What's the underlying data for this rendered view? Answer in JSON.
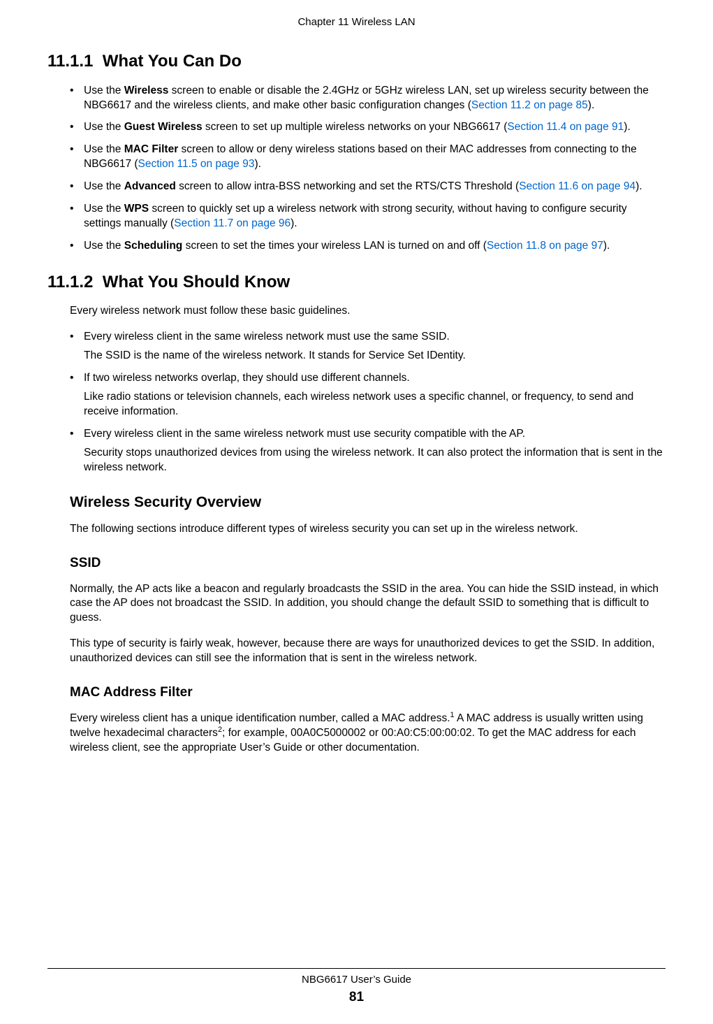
{
  "header": {
    "chapter": "Chapter 11 Wireless LAN"
  },
  "s1": {
    "num": "11.1.1",
    "title": "What You Can Do",
    "bullets": [
      {
        "pre": "Use the ",
        "bold": "Wireless",
        "post1": " screen to enable or disable the 2.4GHz or 5GHz wireless LAN, set up wireless security between the NBG6617 and the wireless clients, and make other basic configuration changes (",
        "link": "Section 11.2 on page 85",
        "post2": ")."
      },
      {
        "pre": "Use the ",
        "bold": "Guest Wireless",
        "post1": " screen to set up multiple wireless networks on your NBG6617 (",
        "link": "Section 11.4 on page 91",
        "post2": ")."
      },
      {
        "pre": "Use the ",
        "bold": "MAC Filter",
        "post1": " screen to allow or deny wireless stations based on their MAC addresses from connecting to the NBG6617 (",
        "link": "Section 11.5 on page 93",
        "post2": ")."
      },
      {
        "pre": "Use the ",
        "bold": "Advanced",
        "post1": " screen to allow intra-BSS networking and set the RTS/CTS Threshold (",
        "link": "Section 11.6 on page 94",
        "post2": ")."
      },
      {
        "pre": "Use the ",
        "bold": "WPS",
        "post1": " screen to quickly set up a wireless network with strong security, without having to configure security settings manually (",
        "link": "Section 11.7 on page 96",
        "post2": ")."
      },
      {
        "pre": "Use the ",
        "bold": "Scheduling",
        "post1": " screen to set the times your wireless LAN is turned on and off (",
        "link": "Section 11.8 on page 97",
        "post2": ")."
      }
    ]
  },
  "s2": {
    "num": "11.1.2",
    "title": "What You Should Know",
    "intro": "Every wireless network must follow these basic guidelines.",
    "bullets": [
      {
        "main": "Every wireless client in the same wireless network must use the same SSID.",
        "sub": "The SSID is the name of the wireless network. It stands for Service Set IDentity."
      },
      {
        "main": "If two wireless networks overlap, they should use different channels.",
        "sub": "Like radio stations or television channels, each wireless network uses a specific channel, or frequency, to send and receive information."
      },
      {
        "main": "Every wireless client in the same wireless network must use security compatible with the AP.",
        "sub": "Security stops unauthorized devices from using the wireless network. It can also protect the information that is sent in the wireless network."
      }
    ]
  },
  "wso": {
    "title": "Wireless Security Overview",
    "p1": "The following sections introduce different types of wireless security you can set up in the wireless network."
  },
  "ssid": {
    "title": "SSID",
    "p1": "Normally, the AP acts like a beacon and regularly broadcasts the SSID in the area. You can hide the SSID instead, in which case the AP does not broadcast the SSID. In addition, you should change the default SSID to something that is difficult to guess.",
    "p2": "This type of security is fairly weak, however, because there are ways for unauthorized devices to get the SSID. In addition, unauthorized devices can still see the information that is sent in the wireless network."
  },
  "mac": {
    "title": "MAC Address Filter",
    "p1a": "Every wireless client has a unique identification number, called a MAC address.",
    "sup1": "1",
    "p1b": " A MAC address is usually written using twelve hexadecimal characters",
    "sup2": "2",
    "p1c": "; for example, 00A0C5000002 or 00:A0:C5:00:00:02. To get the MAC address for each wireless client, see the appropriate User’s Guide or other documentation."
  },
  "footer": {
    "guide": "NBG6617 User’s Guide",
    "page": "81"
  }
}
